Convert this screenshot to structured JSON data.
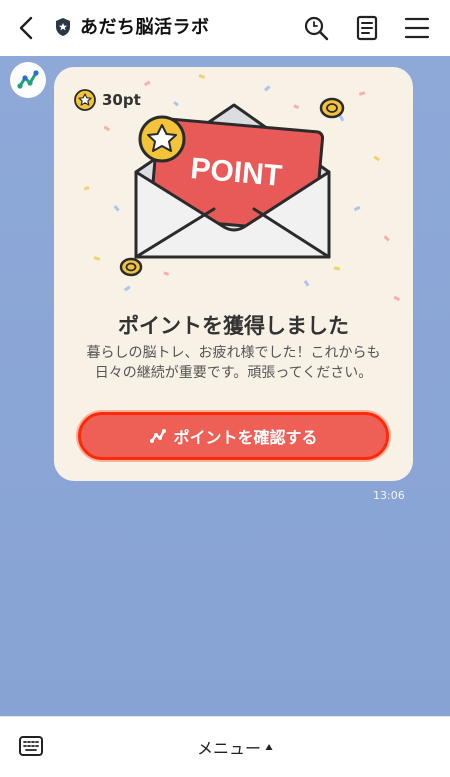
{
  "header": {
    "title": "あだち脳活ラボ",
    "back_icon": "chevron-left-icon",
    "search_icon": "search-icon",
    "notes_icon": "notes-icon",
    "menu_icon": "hamburger-icon"
  },
  "message": {
    "points": "30pt",
    "envelope_text": "POINT",
    "title": "ポイントを獲得しました",
    "body": "暮らしの脳トレ、お疲れ様でした！これからも日々の継続が重要です。頑張ってください。",
    "button_label": "ポイントを確認する",
    "timestamp": "13:06"
  },
  "bottom_bar": {
    "menu_label": "メニュー",
    "keyboard_icon": "keyboard-icon"
  },
  "colors": {
    "chat_background": "#8aa7d6",
    "card_background": "#f8f1e6",
    "button": "#ee5f55",
    "button_outline": "#ff2a0a",
    "envelope_card": "#e85a58",
    "coin": "#f3c33a"
  }
}
